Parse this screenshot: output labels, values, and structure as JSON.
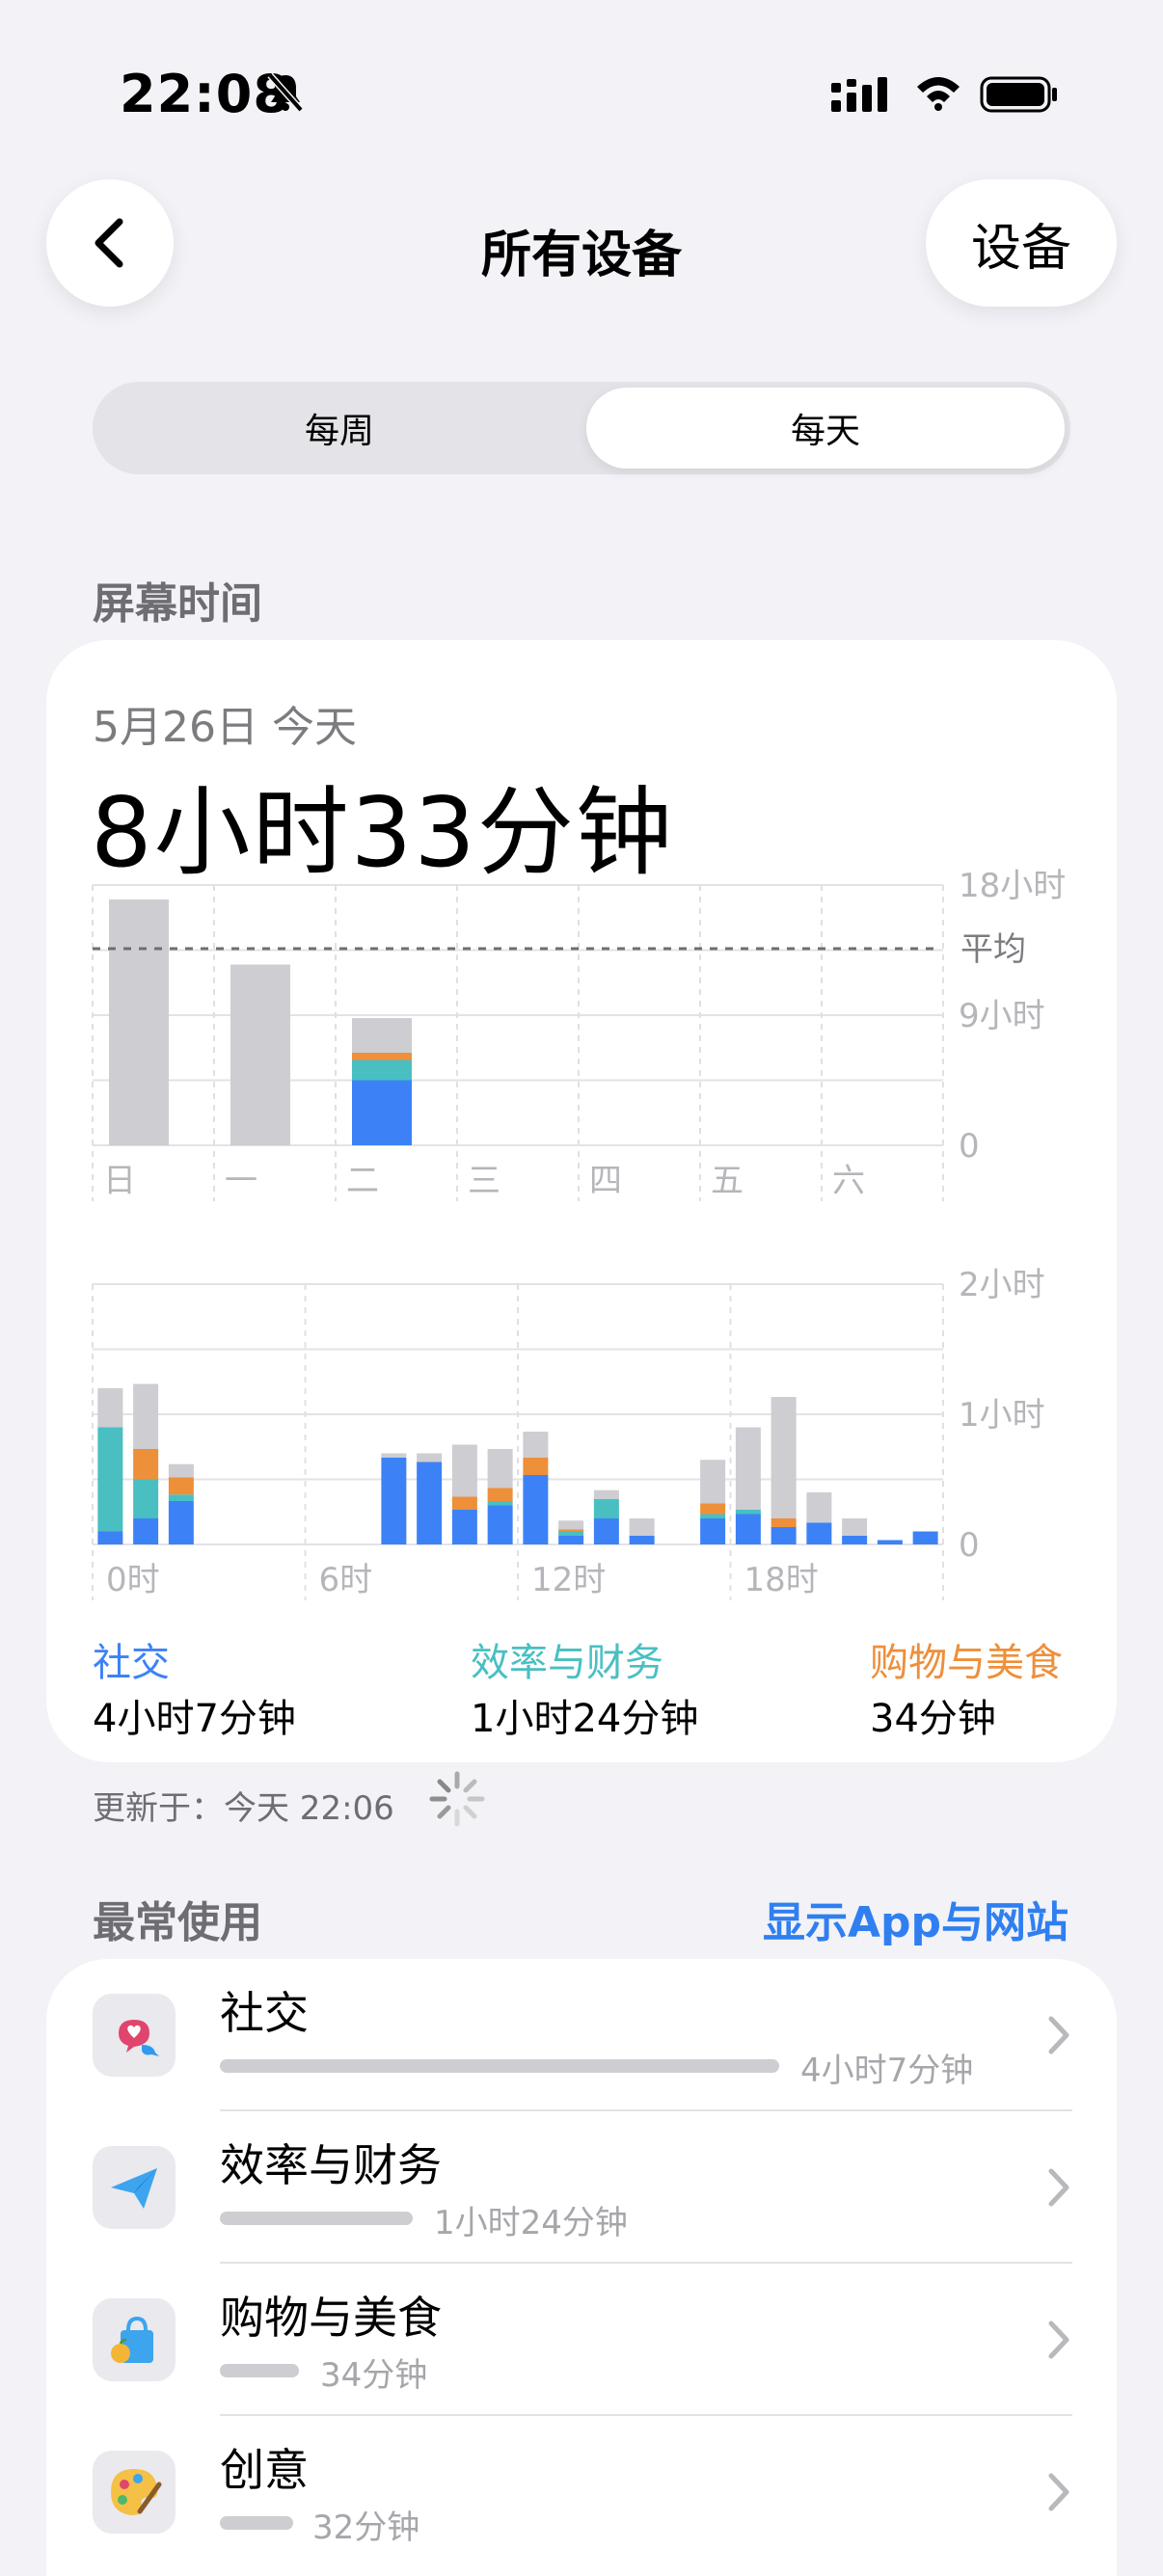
{
  "status_bar": {
    "time": "22:08"
  },
  "nav": {
    "title": "所有设备",
    "settings_label": "设备"
  },
  "segmented": {
    "week": "每周",
    "day": "每天",
    "selected": "每天"
  },
  "screen_time": {
    "section_title": "屏幕时间",
    "date": "5月26日 今天",
    "total": "8小时33分钟",
    "updated": "更新于：今天 22:06"
  },
  "colors": {
    "social": "#3C82F6",
    "productivity": "#49BFC2",
    "shopping": "#EE8F3A",
    "other": "#CDCDD2"
  },
  "chart_data": [
    {
      "type": "bar",
      "categories": [
        "日",
        "一",
        "二",
        "三",
        "四",
        "五",
        "六"
      ],
      "y_ticks": [
        "18小时",
        "9小时",
        "0"
      ],
      "ylim": [
        0,
        18
      ],
      "average": 13.6,
      "average_label": "平均",
      "series": [
        {
          "values": [
            0,
            0,
            4.5,
            0,
            0,
            0,
            0
          ],
          "color": "#3C82F6"
        },
        {
          "values": [
            0,
            0,
            1.4,
            0,
            0,
            0,
            0
          ],
          "color": "#49BFC2"
        },
        {
          "values": [
            0,
            0,
            0.5,
            0,
            0,
            0,
            0
          ],
          "color": "#EE8F3A"
        },
        {
          "values": [
            17.0,
            12.5,
            2.4,
            0,
            0,
            0,
            0
          ],
          "color": "#CDCDD2"
        }
      ]
    },
    {
      "type": "bar",
      "x_ticks": [
        "0时",
        "6时",
        "12时",
        "18时"
      ],
      "y_ticks": [
        "2小时",
        "1小时",
        "0"
      ],
      "ylim": [
        0,
        120
      ],
      "hours": [
        0,
        1,
        2,
        3,
        4,
        5,
        6,
        7,
        8,
        9,
        10,
        11,
        12,
        13,
        14,
        15,
        16,
        17,
        18,
        19,
        20,
        21,
        22,
        23
      ],
      "series": [
        {
          "values": [
            6,
            12,
            20,
            0,
            0,
            0,
            0,
            0,
            40,
            38,
            16,
            18,
            32,
            4,
            12,
            4,
            0,
            12,
            14,
            8,
            10,
            4,
            2,
            6
          ],
          "color": "#3C82F6"
        },
        {
          "values": [
            48,
            18,
            3,
            0,
            0,
            0,
            0,
            0,
            0,
            0,
            0,
            2,
            0,
            2,
            9,
            0,
            0,
            2,
            2,
            0,
            0,
            0,
            0,
            0
          ],
          "color": "#49BFC2"
        },
        {
          "values": [
            0,
            14,
            8,
            0,
            0,
            0,
            0,
            0,
            0,
            0,
            6,
            6,
            8,
            1,
            0,
            0,
            0,
            5,
            0,
            4,
            0,
            0,
            0,
            0
          ],
          "color": "#EE8F3A"
        },
        {
          "values": [
            18,
            30,
            6,
            0,
            0,
            0,
            0,
            0,
            2,
            4,
            24,
            18,
            12,
            4,
            4,
            8,
            0,
            20,
            38,
            56,
            14,
            8,
            0,
            0
          ],
          "color": "#CDCDD2"
        }
      ]
    }
  ],
  "legend": [
    {
      "label": "社交",
      "value": "4小时7分钟"
    },
    {
      "label": "效率与财务",
      "value": "1小时24分钟"
    },
    {
      "label": "购物与美食",
      "value": "34分钟"
    }
  ],
  "most_used": {
    "title": "最常使用",
    "show_link": "显示App与网站",
    "items": [
      {
        "name": "社交",
        "time": "4小时7分钟",
        "fraction": 1.0,
        "icon": "social-icon"
      },
      {
        "name": "效率与财务",
        "time": "1小时24分钟",
        "fraction": 0.34,
        "icon": "productivity-icon"
      },
      {
        "name": "购物与美食",
        "time": "34分钟",
        "fraction": 0.14,
        "icon": "shopping-icon"
      },
      {
        "name": "创意",
        "time": "32分钟",
        "fraction": 0.13,
        "icon": "creativity-icon"
      }
    ]
  }
}
